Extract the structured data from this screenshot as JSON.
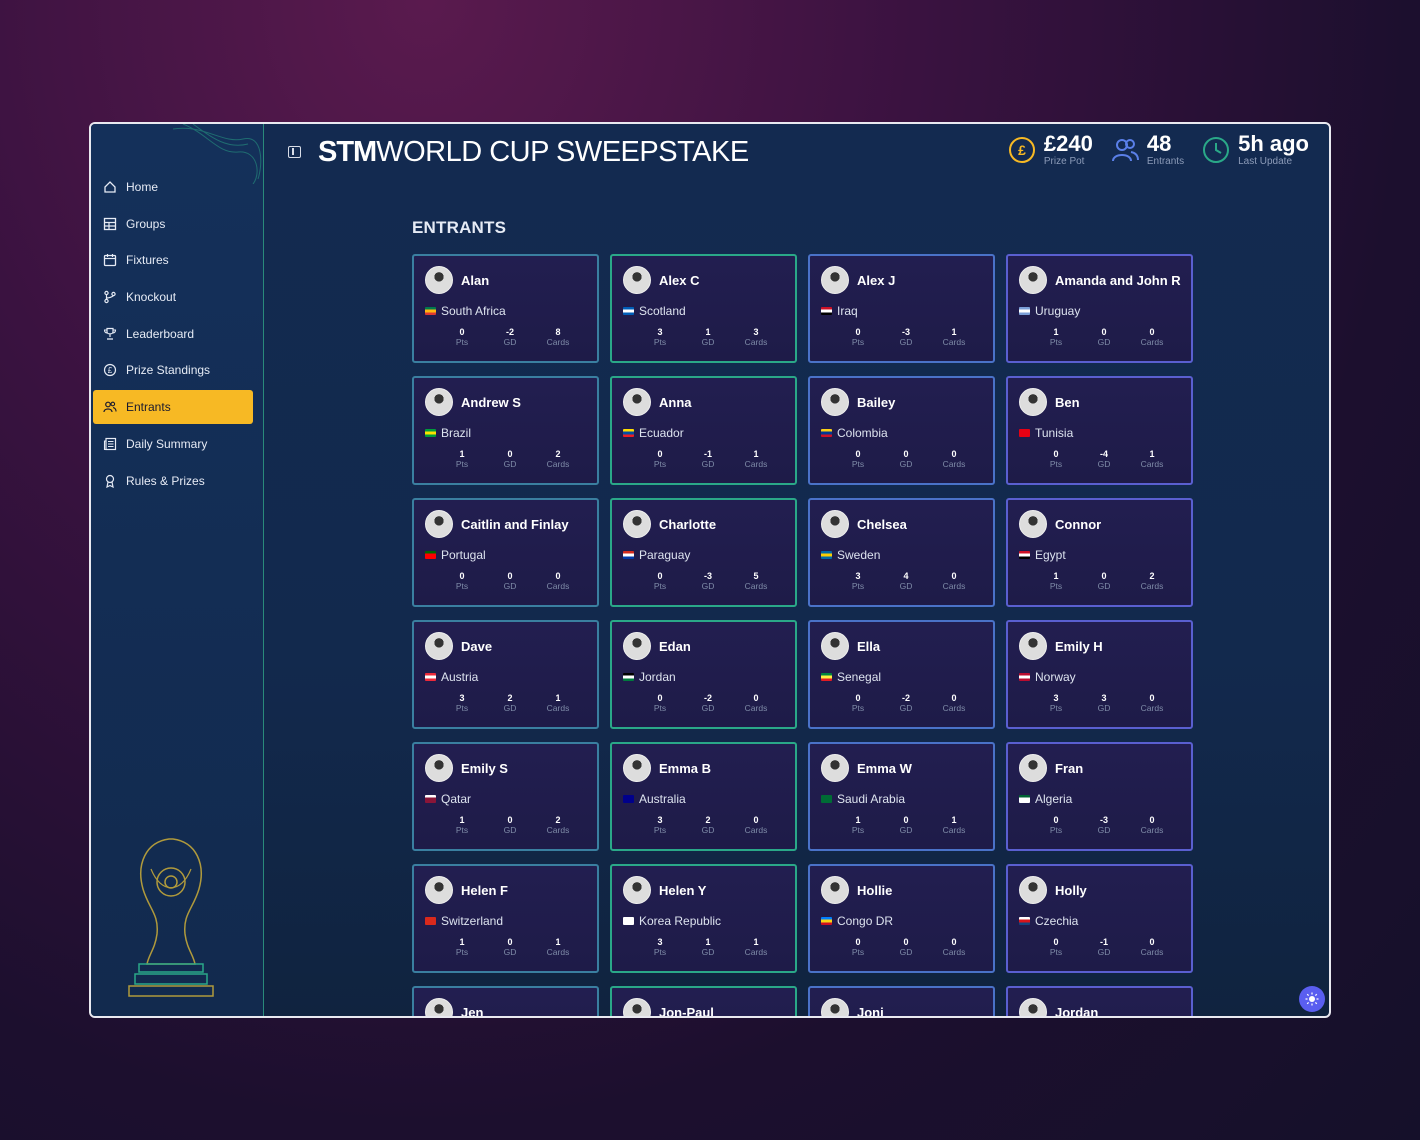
{
  "app": {
    "brand_bold": "STM",
    "brand_rest": "WORLD CUP SWEEPSTAKE"
  },
  "colors": {
    "accent": "#f7b924",
    "pot": "#f7b924",
    "entrants": "#5a7fe8",
    "update": "#2aa888"
  },
  "stats": [
    {
      "icon": "pound-coin-icon",
      "value": "£240",
      "label": "Prize Pot"
    },
    {
      "icon": "users-icon",
      "value": "48",
      "label": "Entrants"
    },
    {
      "icon": "clock-icon",
      "value": "5h ago",
      "label": "Last Update"
    }
  ],
  "nav": [
    {
      "label": "Home",
      "icon": "home-icon"
    },
    {
      "label": "Groups",
      "icon": "table-icon"
    },
    {
      "label": "Fixtures",
      "icon": "calendar-icon"
    },
    {
      "label": "Knockout",
      "icon": "bracket-icon"
    },
    {
      "label": "Leaderboard",
      "icon": "trophy-icon"
    },
    {
      "label": "Prize Standings",
      "icon": "pound-icon"
    },
    {
      "label": "Entrants",
      "icon": "users-icon",
      "active": true
    },
    {
      "label": "Daily Summary",
      "icon": "newspaper-icon"
    },
    {
      "label": "Rules & Prizes",
      "icon": "award-icon"
    }
  ],
  "section_title": "ENTRANTS",
  "metric_labels": [
    "Pts",
    "GD",
    "Cards"
  ],
  "entrants": [
    {
      "name": "Alan",
      "country": "South Africa",
      "pts": "0",
      "gd": "-2",
      "cards": "8",
      "flag": [
        "#007a4d",
        "#ffb612",
        "#de3831"
      ]
    },
    {
      "name": "Alex C",
      "country": "Scotland",
      "pts": "3",
      "gd": "1",
      "cards": "3",
      "flag": [
        "#005eb8",
        "#ffffff",
        "#005eb8"
      ]
    },
    {
      "name": "Alex J",
      "country": "Iraq",
      "pts": "0",
      "gd": "-3",
      "cards": "1",
      "flag": [
        "#ce1126",
        "#ffffff",
        "#000000"
      ]
    },
    {
      "name": "Amanda and John R",
      "country": "Uruguay",
      "pts": "1",
      "gd": "0",
      "cards": "0",
      "flag": [
        "#7b9fd8",
        "#ffffff",
        "#7b9fd8"
      ]
    },
    {
      "name": "Andrew S",
      "country": "Brazil",
      "pts": "1",
      "gd": "0",
      "cards": "2",
      "flag": [
        "#009c3b",
        "#ffdf00",
        "#009c3b"
      ]
    },
    {
      "name": "Anna",
      "country": "Ecuador",
      "pts": "0",
      "gd": "-1",
      "cards": "1",
      "flag": [
        "#ffdd00",
        "#034ea2",
        "#ed1c24"
      ]
    },
    {
      "name": "Bailey",
      "country": "Colombia",
      "pts": "0",
      "gd": "0",
      "cards": "0",
      "flag": [
        "#fcd116",
        "#003893",
        "#ce1126"
      ]
    },
    {
      "name": "Ben",
      "country": "Tunisia",
      "pts": "0",
      "gd": "-4",
      "cards": "1",
      "flag": [
        "#e70013",
        "#e70013",
        "#e70013"
      ]
    },
    {
      "name": "Caitlin and Finlay",
      "country": "Portugal",
      "pts": "0",
      "gd": "0",
      "cards": "0",
      "flag": [
        "#006600",
        "#ff0000",
        "#ff0000"
      ]
    },
    {
      "name": "Charlotte",
      "country": "Paraguay",
      "pts": "0",
      "gd": "-3",
      "cards": "5",
      "flag": [
        "#d52b1e",
        "#ffffff",
        "#0038a8"
      ]
    },
    {
      "name": "Chelsea",
      "country": "Sweden",
      "pts": "3",
      "gd": "4",
      "cards": "0",
      "flag": [
        "#006aa7",
        "#fecc00",
        "#006aa7"
      ]
    },
    {
      "name": "Connor",
      "country": "Egypt",
      "pts": "1",
      "gd": "0",
      "cards": "2",
      "flag": [
        "#ce1126",
        "#ffffff",
        "#000000"
      ]
    },
    {
      "name": "Dave",
      "country": "Austria",
      "pts": "3",
      "gd": "2",
      "cards": "1",
      "flag": [
        "#ed2939",
        "#ffffff",
        "#ed2939"
      ]
    },
    {
      "name": "Edan",
      "country": "Jordan",
      "pts": "0",
      "gd": "-2",
      "cards": "0",
      "flag": [
        "#000000",
        "#ffffff",
        "#007a3d"
      ]
    },
    {
      "name": "Ella",
      "country": "Senegal",
      "pts": "0",
      "gd": "-2",
      "cards": "0",
      "flag": [
        "#00853f",
        "#fdef42",
        "#e31b23"
      ]
    },
    {
      "name": "Emily H",
      "country": "Norway",
      "pts": "3",
      "gd": "3",
      "cards": "0",
      "flag": [
        "#ba0c2f",
        "#ffffff",
        "#ba0c2f"
      ]
    },
    {
      "name": "Emily S",
      "country": "Qatar",
      "pts": "1",
      "gd": "0",
      "cards": "2",
      "flag": [
        "#ffffff",
        "#8a1538",
        "#8a1538"
      ]
    },
    {
      "name": "Emma B",
      "country": "Australia",
      "pts": "3",
      "gd": "2",
      "cards": "0",
      "flag": [
        "#00008b",
        "#00008b",
        "#00008b"
      ]
    },
    {
      "name": "Emma W",
      "country": "Saudi Arabia",
      "pts": "1",
      "gd": "0",
      "cards": "1",
      "flag": [
        "#006c35",
        "#006c35",
        "#006c35"
      ]
    },
    {
      "name": "Fran",
      "country": "Algeria",
      "pts": "0",
      "gd": "-3",
      "cards": "0",
      "flag": [
        "#006233",
        "#ffffff",
        "#ffffff"
      ]
    },
    {
      "name": "Helen F",
      "country": "Switzerland",
      "pts": "1",
      "gd": "0",
      "cards": "1",
      "flag": [
        "#da291c",
        "#da291c",
        "#da291c"
      ]
    },
    {
      "name": "Helen Y",
      "country": "Korea Republic",
      "pts": "3",
      "gd": "1",
      "cards": "1",
      "flag": [
        "#ffffff",
        "#ffffff",
        "#ffffff"
      ]
    },
    {
      "name": "Hollie",
      "country": "Congo DR",
      "pts": "0",
      "gd": "0",
      "cards": "0",
      "flag": [
        "#007fff",
        "#f7d618",
        "#ce1021"
      ]
    },
    {
      "name": "Holly",
      "country": "Czechia",
      "pts": "0",
      "gd": "-1",
      "cards": "0",
      "flag": [
        "#ffffff",
        "#d7141a",
        "#11457e"
      ]
    },
    {
      "name": "Jen",
      "country": "",
      "pts": "",
      "gd": "",
      "cards": "",
      "flag": []
    },
    {
      "name": "Jon-Paul",
      "country": "",
      "pts": "",
      "gd": "",
      "cards": "",
      "flag": []
    },
    {
      "name": "Joni",
      "country": "",
      "pts": "",
      "gd": "",
      "cards": "",
      "flag": []
    },
    {
      "name": "Jordan",
      "country": "",
      "pts": "",
      "gd": "",
      "cards": "",
      "flag": []
    }
  ]
}
